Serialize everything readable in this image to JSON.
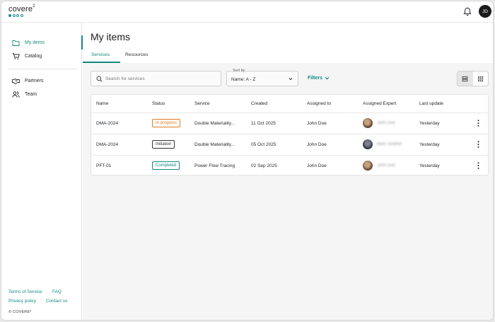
{
  "brand": {
    "name": "covere",
    "sup": "2"
  },
  "user": {
    "initials": "JD"
  },
  "sidebar": {
    "items": [
      {
        "label": "My items",
        "icon": "folder-icon",
        "active": true
      },
      {
        "label": "Catalog",
        "icon": "cart-icon",
        "active": false
      },
      {
        "label": "Partners",
        "icon": "handshake-icon",
        "active": false
      },
      {
        "label": "Team",
        "icon": "team-icon",
        "active": false
      }
    ],
    "footer": {
      "terms": "Terms of Service",
      "faq": "FAQ",
      "privacy": "Privacy policy",
      "contact": "Contact us",
      "copyright": "© COVERE²"
    }
  },
  "main": {
    "title": "My items",
    "tabs": [
      {
        "label": "Services",
        "active": true
      },
      {
        "label": "Resources",
        "active": false
      }
    ],
    "search": {
      "placeholder": "Search for services",
      "value": ""
    },
    "sort": {
      "label": "Sort by",
      "value": "Name: A - Z"
    },
    "filters_label": "Filters"
  },
  "table": {
    "columns": [
      "Name",
      "Status",
      "Service",
      "Created",
      "Assigned to",
      "Assigned Expert",
      "Last update"
    ],
    "rows": [
      {
        "name": "DMA-2024",
        "status": "In progress",
        "status_color": "#e07b1f",
        "service": "Double Materiality...",
        "created": "11 Oct 2025",
        "assigned_to": "John Doe",
        "expert": "John Doe",
        "last_update": "Yesterday"
      },
      {
        "name": "DMA-2024",
        "status": "Initiation",
        "status_color": "#333333",
        "service": "Double Materiality...",
        "created": "05 Oct 2025",
        "assigned_to": "John Doe",
        "expert": "Marc Smither",
        "last_update": "Yesterday"
      },
      {
        "name": "PFT-01",
        "status": "Completed",
        "status_color": "#138a80",
        "service": "Power Flow Tracing",
        "created": "02 Sep 2025",
        "assigned_to": "John Doe",
        "expert": "John Doe",
        "last_update": "Yesterday"
      }
    ]
  },
  "colors": {
    "accent": "#138a80",
    "in_progress": "#e07b1f"
  }
}
